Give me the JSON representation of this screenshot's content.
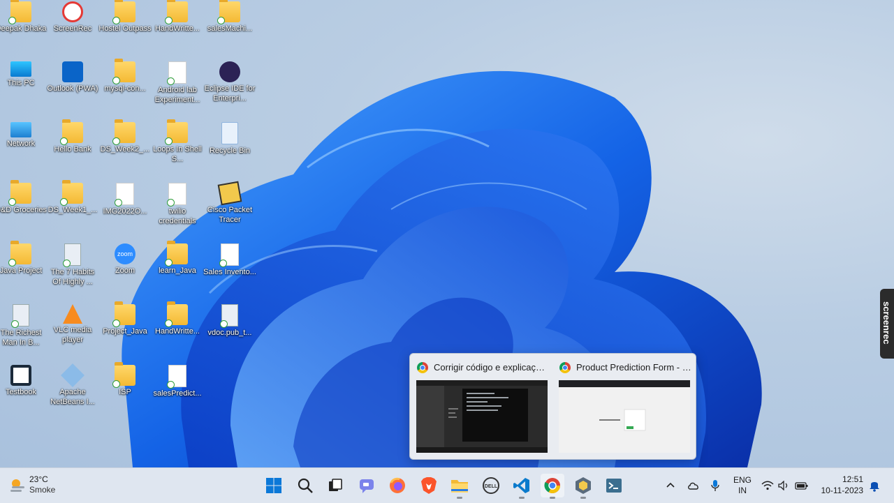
{
  "desktop": {
    "icons": [
      {
        "label": "Deepak Dhaka",
        "kind": "folder"
      },
      {
        "label": "ScreenRec",
        "kind": "screenrec"
      },
      {
        "label": "Hostel Outpass",
        "kind": "folder"
      },
      {
        "label": "HandWritte...",
        "kind": "folder"
      },
      {
        "label": "salesMachi...",
        "kind": "folder"
      },
      {
        "label": "This PC",
        "kind": "monitor"
      },
      {
        "label": "Outlook (PWA)",
        "kind": "outlook"
      },
      {
        "label": "mysql-con...",
        "kind": "folder"
      },
      {
        "label": "Android lab Experiment...",
        "kind": "doc"
      },
      {
        "label": "Eclipse IDE for Enterpri...",
        "kind": "eclipse"
      },
      {
        "label": "Network",
        "kind": "network"
      },
      {
        "label": "Hello Bank",
        "kind": "folder"
      },
      {
        "label": "DS_Week2_...",
        "kind": "folder"
      },
      {
        "label": "Loops In Shell S...",
        "kind": "folder"
      },
      {
        "label": "Recycle Bin",
        "kind": "recycle"
      },
      {
        "label": "D&D Groceries",
        "kind": "folder"
      },
      {
        "label": "DS_Week1_...",
        "kind": "folder"
      },
      {
        "label": "IMG2022O...",
        "kind": "doc"
      },
      {
        "label": "twilio credentials",
        "kind": "doc"
      },
      {
        "label": "Cisco Packet Tracer",
        "kind": "cisco"
      },
      {
        "label": "Java Project",
        "kind": "folder"
      },
      {
        "label": "The 7 Habits Of Highly ...",
        "kind": "book"
      },
      {
        "label": "Zoom",
        "kind": "zoom"
      },
      {
        "label": "learn_Java",
        "kind": "folder"
      },
      {
        "label": "Sales Invento...",
        "kind": "doc"
      },
      {
        "label": "The Richest Man In B...",
        "kind": "book"
      },
      {
        "label": "VLC media player",
        "kind": "vlc"
      },
      {
        "label": "Project_Java",
        "kind": "folder"
      },
      {
        "label": "HandWritte...",
        "kind": "folder"
      },
      {
        "label": "vdoc.pub_t...",
        "kind": "book"
      },
      {
        "label": "Testbook",
        "kind": "testbook"
      },
      {
        "label": "Apache NetBeans I...",
        "kind": "netbeans"
      },
      {
        "label": "ISP",
        "kind": "folder"
      },
      {
        "label": "salesPredict...",
        "kind": "doc"
      }
    ],
    "zoom_badge": "zoom"
  },
  "preview": {
    "windows": [
      {
        "title": "Corrigir código e explicação. ..."
      },
      {
        "title": "Product Prediction Form - Go..."
      }
    ]
  },
  "screenrec_tab": {
    "label": "screenrec"
  },
  "taskbar": {
    "weather": {
      "temp": "23°C",
      "condition": "Smoke"
    },
    "apps": [
      {
        "name": "start-button"
      },
      {
        "name": "search-button"
      },
      {
        "name": "task-view-button"
      },
      {
        "name": "chat-button"
      },
      {
        "name": "firefox-button"
      },
      {
        "name": "brave-button"
      },
      {
        "name": "file-explorer-button"
      },
      {
        "name": "dell-button"
      },
      {
        "name": "vscode-button"
      },
      {
        "name": "chrome-button"
      },
      {
        "name": "app-hex-button"
      },
      {
        "name": "app-terminal-button"
      }
    ],
    "tray": {
      "lang_top": "ENG",
      "lang_bottom": "IN",
      "time": "12:51",
      "date": "10-11-2023"
    }
  },
  "colors": {
    "accent": "#0067c0",
    "bloom": "#1a5fe0"
  }
}
